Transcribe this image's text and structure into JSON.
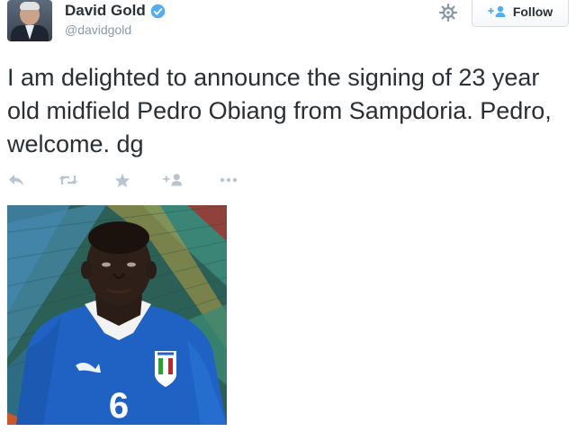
{
  "user": {
    "name": "David Gold",
    "handle": "@davidgold",
    "verified": true
  },
  "header": {
    "follow_label": "Follow"
  },
  "tweet": {
    "text": "I am delighted to announce the signing of 23 year old midfield Pedro Obiang from Sampdoria. Pedro, welcome. dg"
  },
  "actions": [
    {
      "name": "reply",
      "icon": "reply-icon"
    },
    {
      "name": "retweet",
      "icon": "retweet-icon"
    },
    {
      "name": "favorite",
      "icon": "star-icon"
    },
    {
      "name": "follow",
      "icon": "add-user-icon"
    },
    {
      "name": "more",
      "icon": "more-icon"
    }
  ],
  "photo": {
    "jersey_number": "6",
    "brand": "PUMA"
  },
  "colors": {
    "verified": "#55acee",
    "accent": "#55acee",
    "action_icons": "#b8c4ce",
    "text": "#292f33",
    "muted": "#8899a6",
    "jersey": "#1f62c4"
  }
}
